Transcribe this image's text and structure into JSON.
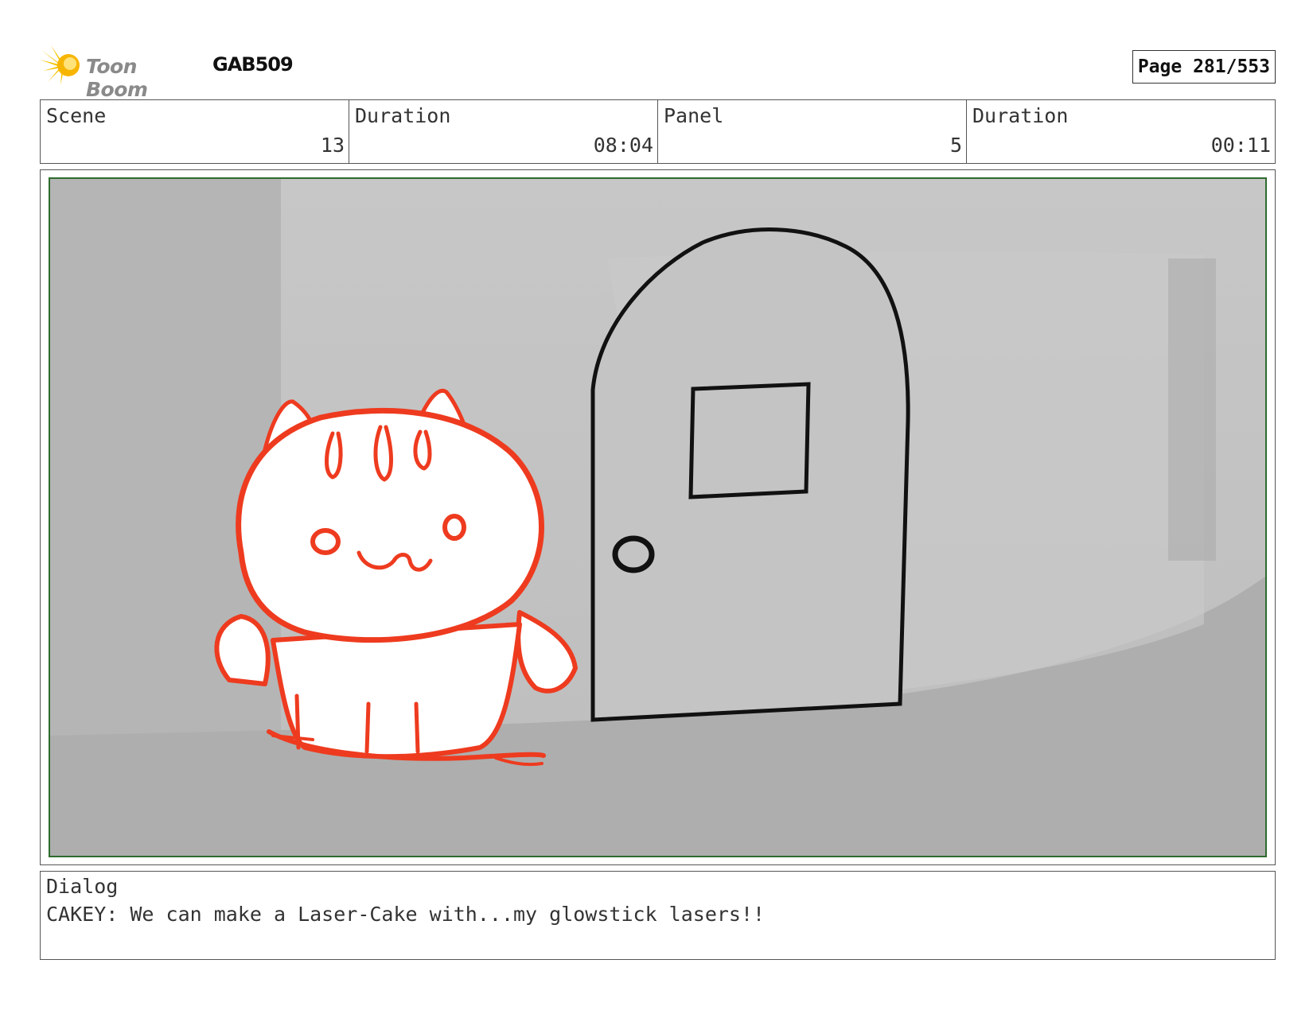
{
  "header": {
    "logo_text": "Toon Boom",
    "logo_icon": "starburst-icon",
    "project_code": "GAB509",
    "page_label": "Page 281/553"
  },
  "info": {
    "scene_label": "Scene",
    "scene_value": "13",
    "scene_duration_label": "Duration",
    "scene_duration_value": "08:04",
    "panel_label": "Panel",
    "panel_value": "5",
    "panel_duration_label": "Duration",
    "panel_duration_value": "00:11"
  },
  "colors": {
    "sketch_red": "#ee3b1f",
    "door_line": "#111111",
    "frame_border": "#2e6b2e",
    "background_grey": "#c4c4c4"
  },
  "dialog": {
    "label": "Dialog",
    "text": "CAKEY: We can make a Laser-Cake with...my glowstick lasers!!"
  }
}
